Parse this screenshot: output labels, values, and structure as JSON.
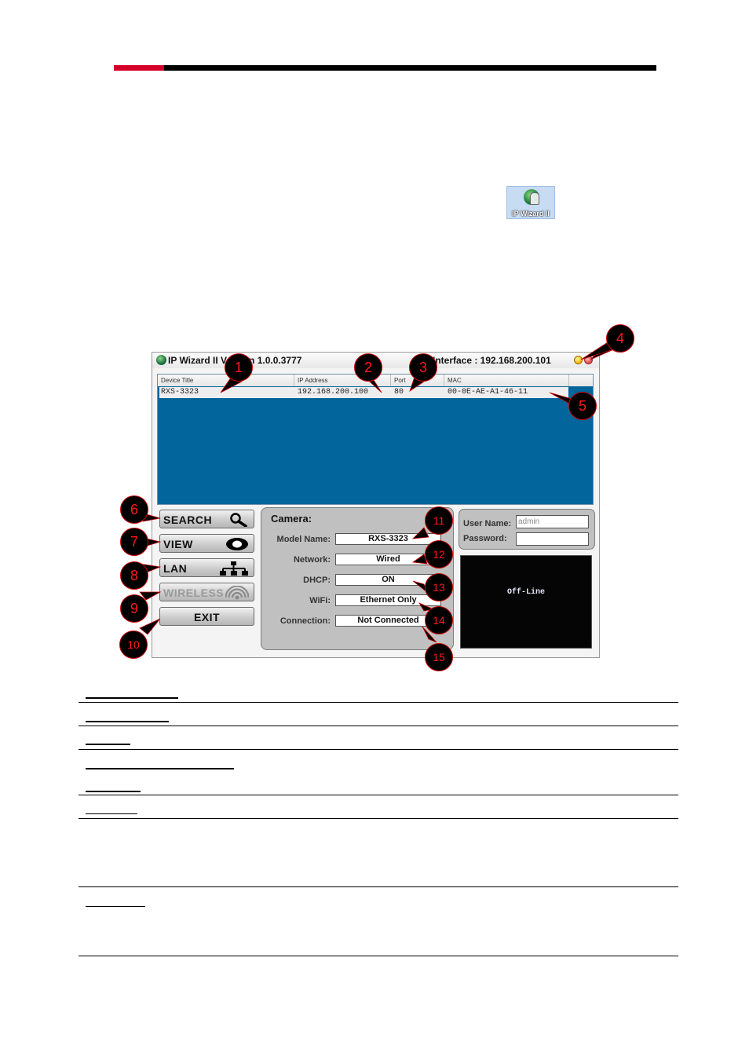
{
  "page_header": {
    "accent_color": "#d4002a",
    "bar_color": "#000000"
  },
  "desktop_icon": {
    "label": "IP Wizard II",
    "icon": "ip-wizard-app-icon"
  },
  "app": {
    "title": "IP Wizard II  Version 1.0.0.3777",
    "interface": "Interface : 192.168.200.101",
    "window_buttons": {
      "minimize": "minimize-icon",
      "close": "close-icon"
    },
    "device_list": {
      "columns": [
        "Device Title",
        "IP Address",
        "Port",
        "MAC"
      ],
      "rows": [
        {
          "device_title": "RXS-3323",
          "ip_address": "192.168.200.100",
          "port": "80",
          "mac": "00-0E-AE-A1-46-11"
        }
      ],
      "background_color": "#02659b"
    },
    "buttons": [
      {
        "label": "SEARCH",
        "icon": "magnifier-icon",
        "enabled": true
      },
      {
        "label": "VIEW",
        "icon": "eye-icon",
        "enabled": true
      },
      {
        "label": "LAN",
        "icon": "network-tree-icon",
        "enabled": true
      },
      {
        "label": "WIRELESS",
        "icon": "wireless-signal-icon",
        "enabled": false
      },
      {
        "label": "EXIT",
        "icon": "",
        "enabled": true
      }
    ],
    "camera": {
      "heading": "Camera:",
      "fields": [
        {
          "label": "Model Name:",
          "value": "RXS-3323"
        },
        {
          "label": "Network:",
          "value": "Wired"
        },
        {
          "label": "DHCP:",
          "value": "ON"
        },
        {
          "label": "WiFi:",
          "value": "Ethernet Only"
        },
        {
          "label": "Connection:",
          "value": "Not Connected"
        }
      ]
    },
    "login": {
      "username_label": "User Name:",
      "username_value": "admin",
      "password_label": "Password:",
      "password_value": ""
    },
    "video": {
      "status_text": "Off-Line"
    }
  },
  "callouts": [
    "1",
    "2",
    "3",
    "4",
    "5",
    "6",
    "7",
    "8",
    "9",
    "10",
    "11",
    "12",
    "13",
    "14",
    "15"
  ]
}
